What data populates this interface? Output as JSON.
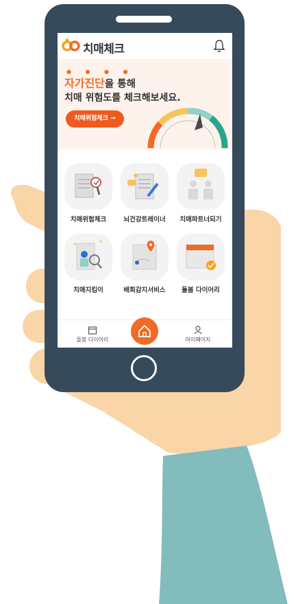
{
  "app": {
    "title": "치매체크"
  },
  "banner": {
    "highlight": "자가진단",
    "line1_rest": "을 통해",
    "line2": "치매 위험도를 체크해보세요.",
    "cta_label": "치매위험체크 →"
  },
  "menu": {
    "items": [
      {
        "label": "치매위험체크"
      },
      {
        "label": "뇌건강트레이너"
      },
      {
        "label": "치매파트너되기"
      },
      {
        "label": "치매지킴이"
      },
      {
        "label": "배회감지서비스"
      },
      {
        "label": "돌봄 다이어리"
      }
    ]
  },
  "nav": {
    "left_label": "돌봄 다이어리",
    "right_label": "마이페이지"
  },
  "colors": {
    "accent": "#f26a25",
    "phone_body": "#374a5c",
    "skin": "#f9d5a7",
    "sleeve": "#83bcbd"
  },
  "icons": [
    "logo-icon",
    "bell-icon",
    "calendar-icon",
    "home-icon",
    "person-icon"
  ]
}
